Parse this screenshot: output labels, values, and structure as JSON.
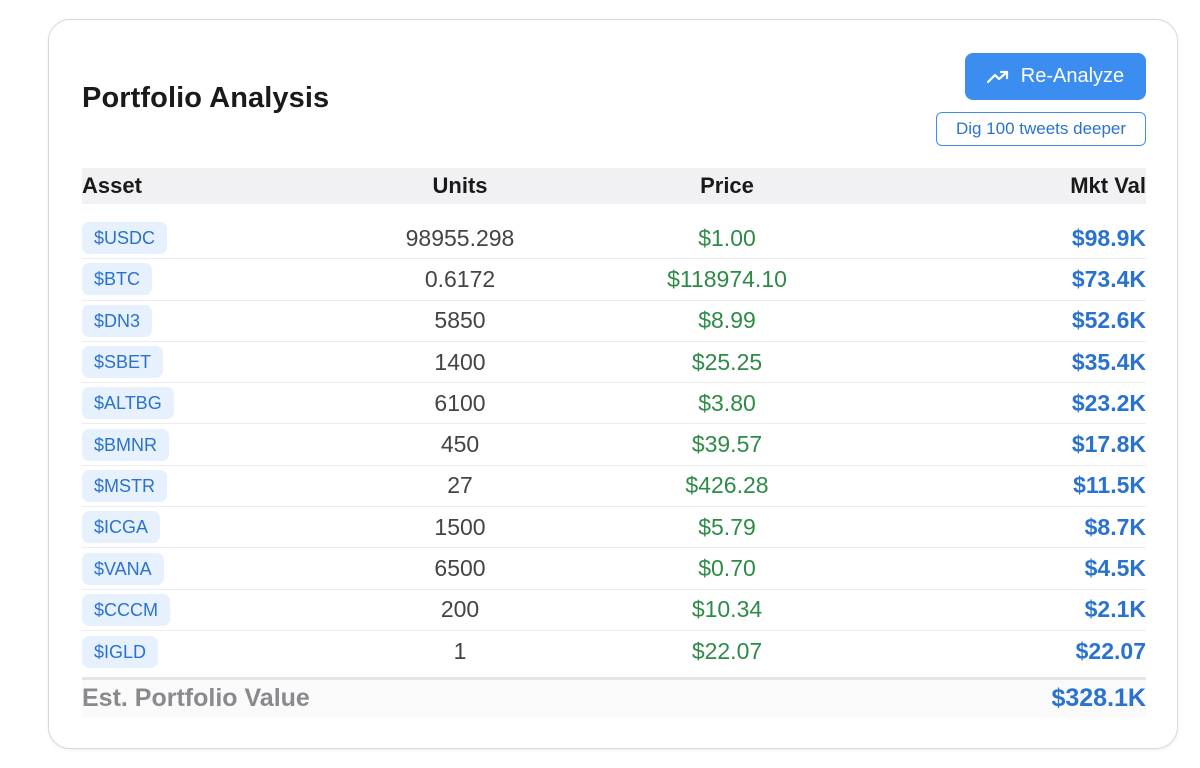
{
  "panel": {
    "title": "Portfolio Analysis",
    "reanalyze_label": "Re-Analyze",
    "dig_label": "Dig 100 tweets deeper"
  },
  "table": {
    "headers": {
      "asset": "Asset",
      "units": "Units",
      "price": "Price",
      "mkt_val": "Mkt Val"
    },
    "rows": [
      {
        "asset": "$USDC",
        "units": "98955.298",
        "price": "$1.00",
        "mkt_val": "$98.9K"
      },
      {
        "asset": "$BTC",
        "units": "0.6172",
        "price": "$118974.10",
        "mkt_val": "$73.4K"
      },
      {
        "asset": "$DN3",
        "units": "5850",
        "price": "$8.99",
        "mkt_val": "$52.6K"
      },
      {
        "asset": "$SBET",
        "units": "1400",
        "price": "$25.25",
        "mkt_val": "$35.4K"
      },
      {
        "asset": "$ALTBG",
        "units": "6100",
        "price": "$3.80",
        "mkt_val": "$23.2K"
      },
      {
        "asset": "$BMNR",
        "units": "450",
        "price": "$39.57",
        "mkt_val": "$17.8K"
      },
      {
        "asset": "$MSTR",
        "units": "27",
        "price": "$426.28",
        "mkt_val": "$11.5K"
      },
      {
        "asset": "$ICGA",
        "units": "1500",
        "price": "$5.79",
        "mkt_val": "$8.7K"
      },
      {
        "asset": "$VANA",
        "units": "6500",
        "price": "$0.70",
        "mkt_val": "$4.5K"
      },
      {
        "asset": "$CCCM",
        "units": "200",
        "price": "$10.34",
        "mkt_val": "$2.1K"
      },
      {
        "asset": "$IGLD",
        "units": "1",
        "price": "$22.07",
        "mkt_val": "$22.07"
      }
    ]
  },
  "total": {
    "label": "Est. Portfolio Value",
    "value": "$328.1K"
  },
  "icons": {
    "reanalyze": "trending-up-icon"
  },
  "colors": {
    "accent": "#3b8df0",
    "ticker_text": "#2a72cf",
    "ticker_bg": "#e6f1fd",
    "price_green": "#2e8b47",
    "total_label": "#8a8a8e"
  }
}
